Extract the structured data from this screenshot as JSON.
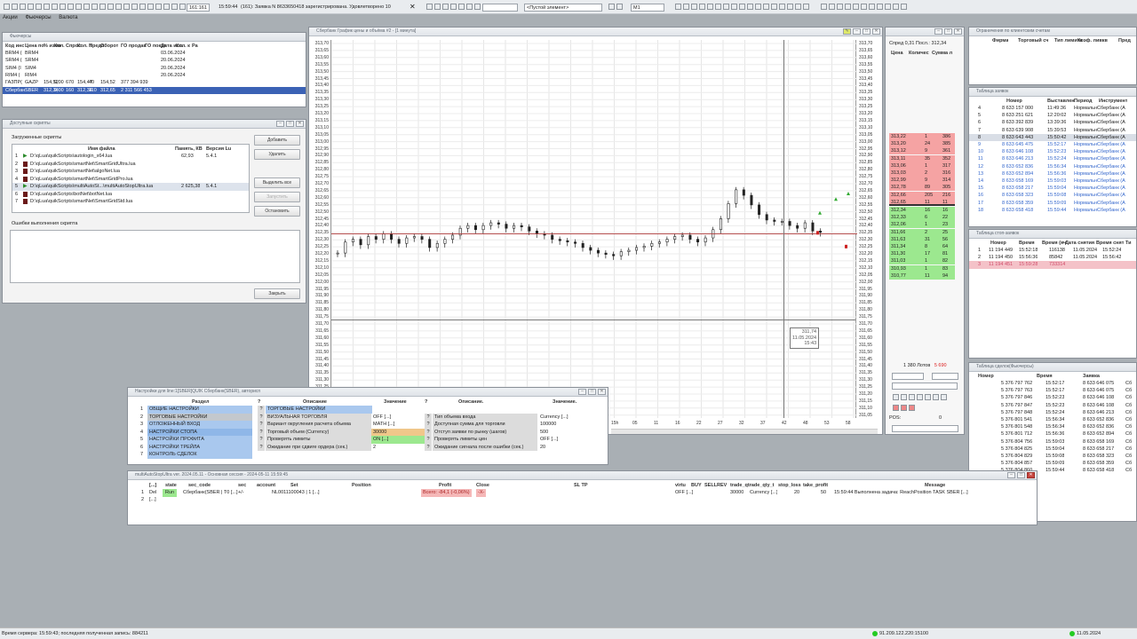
{
  "menu": [
    "Акции",
    "Фьючерсы",
    "Валюта"
  ],
  "toolbar": {
    "counter": "161:161",
    "time": "15:59:44",
    "message": "(161): Заявка N 8633650418 зарегистрирована. Удовлетворено 10",
    "search_value": "",
    "empty_element": "<Пустой элемент>",
    "interval": "M1"
  },
  "futures": {
    "title": "Фьючерсы",
    "headers": [
      "Код инс",
      "Цена по",
      "% измо",
      "Кол.",
      "Спрос",
      "Кол. п",
      "Предл.",
      "Оборот",
      "ГО продав",
      "ГО покуп",
      "Дата исп.",
      "Кол. к",
      "Ра"
    ],
    "rows": [
      [
        "BRM4 (",
        "BRM4",
        "",
        "",
        "",
        "",
        "",
        "",
        "",
        "",
        "03.06.2024",
        "",
        ""
      ],
      [
        "SRM4 (",
        "SRM4",
        "",
        "",
        "",
        "",
        "",
        "",
        "",
        "",
        "20.06.2024",
        "",
        ""
      ],
      [
        "SIM4 (I",
        "SIM4",
        "",
        "",
        "",
        "",
        "",
        "",
        "",
        "",
        "20.06.2024",
        "",
        ""
      ],
      [
        "RIM4 (",
        "RIM4",
        "",
        "",
        "",
        "",
        "",
        "",
        "",
        "",
        "20.06.2024",
        "",
        ""
      ],
      [
        "ГАЗПР(",
        "GAZP",
        "154,52",
        "0,00",
        "670",
        "154,47",
        "40",
        "154,52",
        "377 394 939",
        "",
        "",
        "",
        ""
      ],
      [
        "Сбербан",
        "SBER",
        "312,34",
        "0,00",
        "160",
        "312,34",
        "110",
        "312,65",
        "2 311 566 453",
        "",
        "",
        "",
        ""
      ]
    ]
  },
  "scripts": {
    "title": "Доступные скрипты",
    "loaded_label": "Загруженные скрипты",
    "headers": [
      "Имя файла",
      "Память, КВ",
      "Версия Lu"
    ],
    "rows": [
      {
        "n": "1",
        "path": "D:\\qLua\\quikScripts\\autologin_x64.lua",
        "mem": "62,93",
        "ver": "5.4.1",
        "run": true
      },
      {
        "n": "2",
        "path": "D:\\qLua\\quikScripts\\smartNet\\SmartGridUltra.lua",
        "mem": "",
        "ver": "",
        "run": false
      },
      {
        "n": "3",
        "path": "D:\\qLua\\quikScripts\\smartNet\\algoNet.lua",
        "mem": "",
        "ver": "",
        "run": false
      },
      {
        "n": "4",
        "path": "D:\\qLua\\quikScripts\\smartNet\\SmartGridPro.lua",
        "mem": "",
        "ver": "",
        "run": false
      },
      {
        "n": "5",
        "path": "D:\\qLua\\quikScripts\\multiAutoSt...\\multiAutoStopUltra.lua",
        "mem": "2 625,38",
        "ver": "5.4.1",
        "run": true
      },
      {
        "n": "6",
        "path": "D:\\qLua\\quikScripts\\botNet\\botNet.lua",
        "mem": "",
        "ver": "",
        "run": false
      },
      {
        "n": "7",
        "path": "D:\\qLua\\quikScripts\\smartNet\\SmartGridStd.lua",
        "mem": "",
        "ver": "",
        "run": false
      }
    ],
    "buttons": {
      "add": "Добавить",
      "remove": "Удалить",
      "select_all": "Выделить все",
      "start": "Запустить",
      "stop": "Остановить",
      "close": "Закрыть"
    },
    "errors_label": "Ошибки выполнения скрипта"
  },
  "chart": {
    "title": "Сбербанк График цены и объёма #2 - [1 минута]",
    "crosshair_price": "311,74",
    "crosshair_date": "11.05.2024",
    "crosshair_time": "15:43",
    "x_ticks": [
      "15h",
      "05",
      "11",
      "16",
      "22",
      "27",
      "32",
      "37",
      "42",
      "48",
      "53",
      "58"
    ]
  },
  "chart_data": {
    "type": "candlestick",
    "ylim": [
      311.0,
      313.75
    ],
    "y_ticks": [
      "313,70",
      "313,65",
      "313,60",
      "313,55",
      "313,50",
      "313,45",
      "313,40",
      "313,35",
      "313,30",
      "313,25",
      "313,20",
      "313,15",
      "313,10",
      "313,05",
      "313,00",
      "312,95",
      "312,90",
      "312,85",
      "312,80",
      "312,75",
      "312,70",
      "312,65",
      "312,60",
      "312,55",
      "312,50",
      "312,45",
      "312,40",
      "312,35",
      "312,30",
      "312,25",
      "312,20",
      "312,15",
      "312,10",
      "312,05",
      "312,00",
      "311,95",
      "311,90",
      "311,85",
      "311,80",
      "311,75",
      "311,70",
      "311,65",
      "311,60",
      "311,55",
      "311,50",
      "311,45",
      "311,40",
      "311,35",
      "311,30",
      "311,25",
      "311,20",
      "311,15",
      "311,10",
      "311,05"
    ],
    "y_ticks_right": [
      "313,70",
      "313,65",
      "313,60",
      "313,55",
      "313,50",
      "313,45",
      "313,40",
      "313,35",
      "313,30",
      "313,25",
      "313,20",
      "313,15",
      "313,10",
      "313,05",
      "313,00",
      "312,95",
      "312,90",
      "312,85",
      "312,80",
      "312,75",
      "312,70",
      "312,65",
      "312,60",
      "312,55",
      "312,50",
      "312,45",
      "312,40",
      "312,35",
      "312,30",
      "312,25",
      "312,20",
      "312,15",
      "312,10",
      "312,05",
      "312,00",
      "311,95",
      "311,90",
      "311,85",
      "311,80",
      "311,75",
      "311,70",
      "311,65",
      "311,60",
      "311,55",
      "311,50",
      "311,45",
      "311,40",
      "311,35",
      "311,30",
      "311,25",
      "311,20",
      "311,15",
      "311,10",
      "311,05"
    ],
    "close": [
      312.2,
      312.28,
      312.3,
      312.26,
      312.32,
      312.3,
      312.34,
      312.3,
      312.27,
      312.31,
      312.32,
      312.3,
      312.24,
      312.27,
      312.3,
      312.33,
      312.38,
      312.4,
      312.37,
      312.4,
      312.42,
      312.41,
      312.38,
      312.4,
      312.39,
      312.36,
      312.34,
      312.33,
      312.3,
      312.29,
      312.28,
      312.27,
      312.24,
      312.22,
      312.2,
      312.19,
      312.18,
      312.21,
      312.22,
      312.24,
      312.25,
      312.27,
      312.28,
      312.3,
      312.32,
      312.33,
      312.3,
      312.28,
      312.31,
      312.37,
      312.45,
      312.56,
      312.66,
      312.62,
      312.55,
      312.48,
      312.44,
      312.43,
      312.43,
      312.4,
      312.38,
      312.42,
      312.36,
      312.35
    ],
    "horizontal_line": 312.34
  },
  "orderbook": {
    "info": "Спред 0,31 Посл.: 312,34",
    "headers": [
      "Цена",
      "Количес",
      "Сумма л"
    ],
    "asks": [
      [
        "313,22",
        "1",
        "386"
      ],
      [
        "313,20",
        "24",
        "385"
      ],
      [
        "313,12",
        "9",
        "361"
      ],
      [
        "313,11",
        "35",
        "352"
      ],
      [
        "313,06",
        "1",
        "317"
      ],
      [
        "313,03",
        "2",
        "316"
      ],
      [
        "312,99",
        "9",
        "314"
      ],
      [
        "312,78",
        "89",
        "305"
      ],
      [
        "312,66",
        "205",
        "216"
      ],
      [
        "312,65",
        "11",
        "11"
      ]
    ],
    "bids": [
      [
        "312,34",
        "16",
        "16"
      ],
      [
        "312,33",
        "6",
        "22"
      ],
      [
        "312,06",
        "1",
        "23"
      ],
      [
        "311,66",
        "2",
        "25"
      ],
      [
        "311,63",
        "31",
        "56"
      ],
      [
        "311,34",
        "8",
        "64"
      ],
      [
        "311,30",
        "17",
        "81"
      ],
      [
        "311,03",
        "1",
        "82"
      ],
      [
        "310,93",
        "1",
        "83"
      ],
      [
        "310,77",
        "11",
        "94"
      ]
    ],
    "lots": "1 380 Лотов",
    "lots_red": "5 690",
    "pos_label": "POS:",
    "pos_value": "0"
  },
  "client_limits": {
    "title": "Ограничения по клиентским счетам",
    "headers": [
      "Фирма",
      "Торговый сч",
      "Тип лимита",
      "Коэф. ливкв",
      "Пред"
    ]
  },
  "orders": {
    "title": "Таблица заявок",
    "headers": [
      "Номер",
      "Выставлен",
      "Период",
      "Инструмент"
    ],
    "rows": [
      [
        "4",
        "8 633 157 000",
        "11:49:36",
        "НормальнСбербанк (А"
      ],
      [
        "5",
        "8 633 251 621",
        "12:20:02",
        "НормальнСбербанк (А"
      ],
      [
        "6",
        "8 633 392 839",
        "13:39:36",
        "НормальнСбербанк (А"
      ],
      [
        "7",
        "8 633 639 908",
        "15:39:53",
        "НормальнСбербанк (А"
      ],
      [
        "8",
        "8 633 643 443",
        "15:50:42",
        "НормальнСбербанк (А"
      ],
      [
        "9",
        "8 633 645 475",
        "15:52:17",
        "НормальнСбербанк (А"
      ],
      [
        "10",
        "8 633 646 108",
        "15:52:23",
        "НормальнСбербанк (А"
      ],
      [
        "11",
        "8 633 646 213",
        "15:52:24",
        "НормальнСбербанк (А"
      ],
      [
        "12",
        "8 633 652 836",
        "15:56:34",
        "НормальнСбербанк (А"
      ],
      [
        "13",
        "8 633 652 894",
        "15:56:36",
        "НормальнСбербанк (А"
      ],
      [
        "14",
        "8 633 658 169",
        "15:59:03",
        "НормальнСбербанк (А"
      ],
      [
        "15",
        "8 633 658 217",
        "15:59:04",
        "НормальнСбербанк (А"
      ],
      [
        "16",
        "8 633 658 323",
        "15:59:08",
        "НормальнСбербанк (А"
      ],
      [
        "17",
        "8 633 658 359",
        "15:59:09",
        "НормальнСбербанк (А"
      ],
      [
        "18",
        "8 633 658 418",
        "15:59:44",
        "НормальнСбербанк (А"
      ]
    ]
  },
  "stop_orders": {
    "title": "Таблица стоп-заявок",
    "headers": [
      "Номер",
      "Время",
      "Время (яч",
      "Дата снятия",
      "Время снят",
      "Ти"
    ],
    "rows": [
      [
        "1",
        "11 194 449",
        "15:52:18",
        "116138",
        "11.05.2024",
        "15:52:24"
      ],
      [
        "2",
        "11 194 450",
        "15:56:36",
        "85842",
        "11.05.2024",
        "15:56:42"
      ],
      [
        "3",
        "11 194 451",
        "15:59:28",
        "733314",
        "",
        ""
      ]
    ]
  },
  "trades": {
    "title": "Таблица сделок(Фьючерсы)",
    "headers": [
      "Номер",
      "Время",
      "Заявка"
    ],
    "rows": [
      [
        "5 376 797 762",
        "15:52:17",
        "8 633 646 075",
        "Сб"
      ],
      [
        "5 376 797 763",
        "15:52:17",
        "8 633 646 075",
        "Сб"
      ],
      [
        "5 376 797 846",
        "15:52:23",
        "8 633 646 108",
        "Сб"
      ],
      [
        "5 376 797 847",
        "15:52:23",
        "8 633 646 108",
        "Сб"
      ],
      [
        "5 376 797 848",
        "15:52:24",
        "8 633 646 213",
        "Сб"
      ],
      [
        "5 376 801 541",
        "15:56:34",
        "8 633 652 836",
        "Сб"
      ],
      [
        "5 376 801 548",
        "15:56:34",
        "8 633 652 836",
        "Сб"
      ],
      [
        "5 376 801 712",
        "15:56:36",
        "8 633 652 894",
        "Сб"
      ],
      [
        "5 376 804 756",
        "15:59:03",
        "8 633 658 169",
        "Сб"
      ],
      [
        "5 376 804 825",
        "15:59:04",
        "8 633 658 217",
        "Сб"
      ],
      [
        "5 376 804 829",
        "15:59:08",
        "8 633 658 323",
        "Сб"
      ],
      [
        "5 376 804 857",
        "15:59:09",
        "8 633 658 359",
        "Сб"
      ],
      [
        "5 376 804 860",
        "15:59:44",
        "8 633 658 418",
        "Сб"
      ]
    ]
  },
  "settings": {
    "title": "Настройки для line:1[SBER]QUIK Сбербанк(SBER), авторисп",
    "headers": [
      "Раздел",
      "?",
      "Описание",
      "Значение",
      "?",
      "Описание.",
      "Значение."
    ],
    "sections": [
      "ОБЩИЕ НАСТРОЙКИ",
      "ТОРГОВЫЕ НАСТРОЙКИ",
      "ОТЛОЖЕННЫЙ ВХОД",
      "НАСТРОЙКИ СТОПА",
      "НАСТРОЙКИ ПРОФИТА",
      "НАСТРОЙКИ ТРЕЙЛА",
      "КОНТРОЛЬ СДЕЛОК"
    ],
    "left_rows": [
      [
        "ТОРГОВЫЕ НАСТРОЙКИ",
        ""
      ],
      [
        "ВИЗУАЛЬНАЯ ТОРГОВЛЯ",
        "OFF [...]"
      ],
      [
        "Вариант округления расчета объема",
        "MATH [...]"
      ],
      [
        "Торговый объем (Currency)",
        "30000"
      ],
      [
        "Проверять лимиты",
        "ON [...]"
      ],
      [
        "Ожидание при сдвиге ордера (сек.)",
        "2"
      ]
    ],
    "right_rows": [
      [
        "",
        ""
      ],
      [
        "Тип объема входа",
        "Currency [...]"
      ],
      [
        "Доступная сумма для торговли",
        "100000"
      ],
      [
        "Отступ заявки по рынку (шагов)",
        "500"
      ],
      [
        "Проверять лимиты цен",
        "OFF [...]"
      ],
      [
        "Ожидание сигнала после ошибки (сек.)",
        "20"
      ]
    ]
  },
  "robot": {
    "title": "multiAutoStopUltra ver. 2024.05.11 - Основная сессия - 2024-05-11 15:59:45",
    "headers": [
      "[...]",
      "state",
      "sec_code",
      "sec",
      "account",
      "Set",
      "Position",
      "Profit",
      "Close",
      "SL TP",
      "virtu",
      "BUY",
      "SELL",
      "REV",
      "trade_qtrade_qty_t",
      "stop_loss",
      "take_profit",
      "Message"
    ],
    "row1": [
      "Del",
      "Run",
      "Сбербанк(SBER | T0 [...]",
      "+/-",
      "NL0011100043 | 1 [...]",
      "",
      "",
      "Всего: -84,1 (-0,06%)",
      "-X-",
      "",
      "OFF [...]",
      "",
      "",
      "",
      "30000",
      "Currency [...]",
      "20",
      "50",
      "15:59:44 Выполнена задача: ReachPosition TASK SBER [...]"
    ],
    "row2_first": "[...]"
  },
  "statusbar": {
    "left": "Время сервера: 15:59:43; последняя полученная запись: 884211",
    "server": "91.209.122.220:15100",
    "date": "11.05.2024"
  }
}
